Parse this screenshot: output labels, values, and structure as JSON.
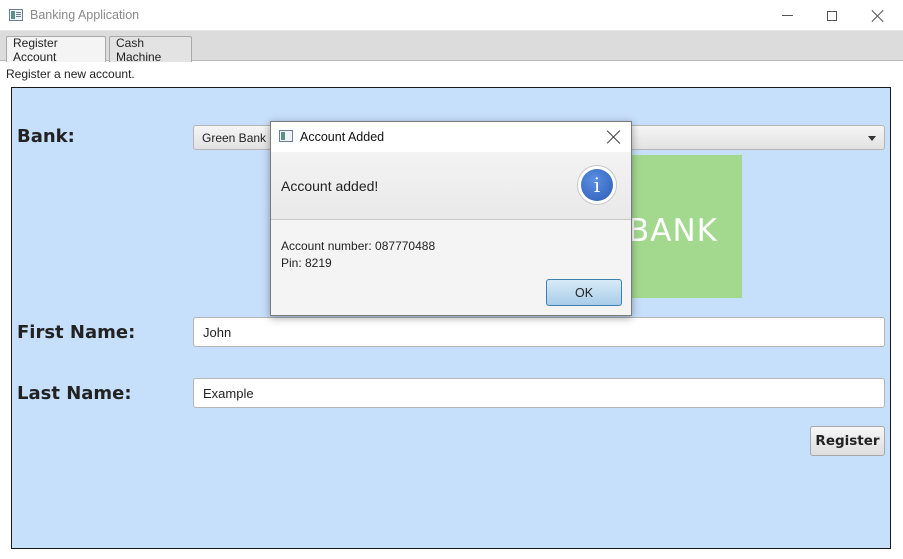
{
  "window": {
    "title": "Banking Application",
    "controls": [
      "minimize",
      "maximize",
      "close"
    ]
  },
  "tabs": [
    {
      "label": "Register Account",
      "active": true
    },
    {
      "label": "Cash Machine",
      "active": false
    }
  ],
  "page": {
    "subtitle": "Register a new account."
  },
  "form": {
    "bank_label": "Bank:",
    "bank_selected": "Green Bank",
    "logo_text": "BANK",
    "first_name_label": "First Name:",
    "first_name_value": "John",
    "last_name_label": "Last Name:",
    "last_name_value": "Example",
    "register_label": "Register"
  },
  "dialog": {
    "title": "Account Added",
    "heading": "Account added!",
    "account_number_line": "Account number: 087770488",
    "pin_line": "Pin: 8219",
    "ok_label": "OK",
    "icon": "info-icon"
  },
  "colors": {
    "panel_bg": "#c6dffb",
    "logo_bg": "#a3d98f",
    "info_icon": "#2f64c0"
  }
}
